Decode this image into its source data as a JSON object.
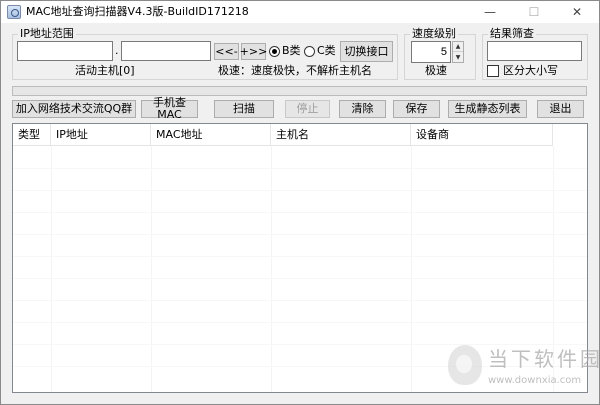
{
  "window": {
    "title": "MAC地址查询扫描器V4.3版-BuildID171218",
    "minimize_glyph": "—",
    "maximize_glyph": "☐",
    "close_glyph": "✕"
  },
  "ip_range": {
    "group_label": "IP地址范围",
    "start_value": "",
    "end_value": "",
    "separator": ".",
    "prev_label": "<<-",
    "next_label": "+>>",
    "radio_b_label": "B类",
    "radio_c_label": "C类",
    "switch_label": "切换接口",
    "active_hosts": "活动主机[0]",
    "speed_hint": "极速：速度极快，不解析主机名"
  },
  "speed": {
    "group_label": "速度级别",
    "value": "5",
    "mode_label": "极速",
    "up_glyph": "▲",
    "down_glyph": "▼"
  },
  "filter": {
    "group_label": "结果筛查",
    "value": "",
    "case_label": "区分大小写"
  },
  "toolbar": {
    "qq_group": "加入网络技术交流QQ群",
    "phone_mac": "手机查MAC",
    "scan": "扫描",
    "stop": "停止",
    "clear": "清除",
    "save": "保存",
    "static_list": "生成静态列表",
    "exit": "退出"
  },
  "table": {
    "columns": [
      "类型",
      "IP地址",
      "MAC地址",
      "主机名",
      "设备商"
    ]
  },
  "watermark": {
    "text": "当下软件园",
    "url": "www.downxia.com"
  }
}
